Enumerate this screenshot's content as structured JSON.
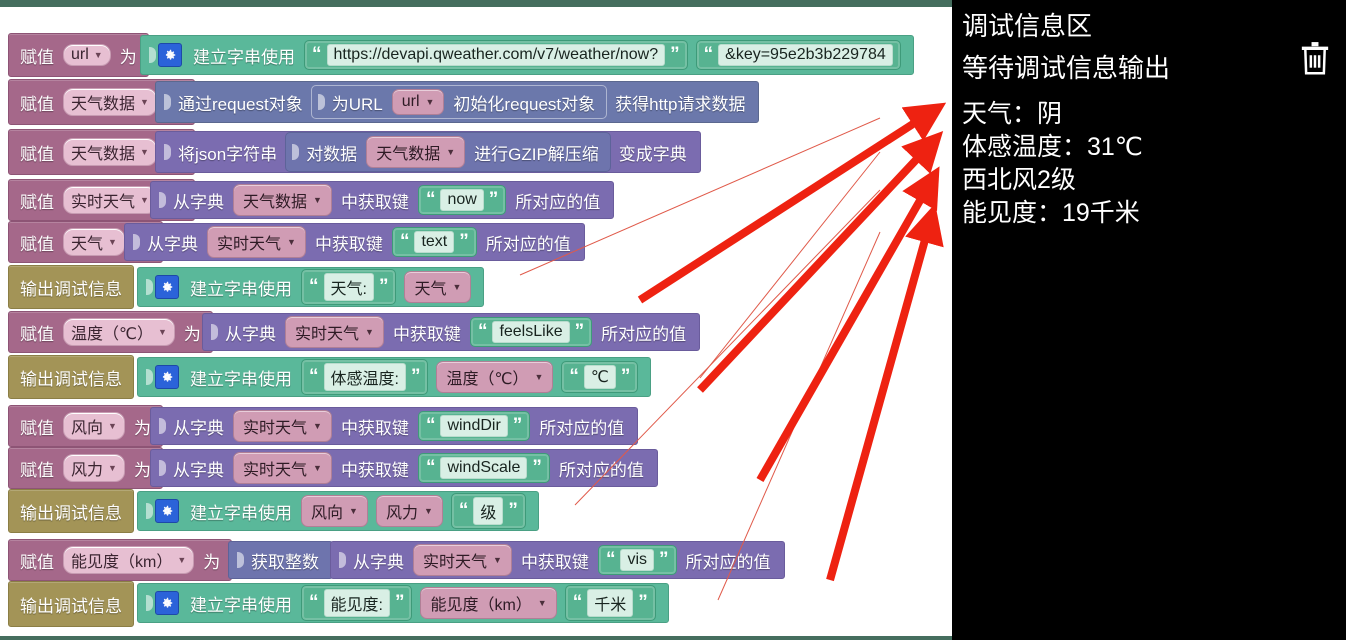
{
  "workspace": {
    "rows": [
      {
        "id": "row-url",
        "kind": "assign",
        "prefix": "赋值",
        "variable": "url",
        "suffix": "为",
        "value_block": {
          "kind": "create-text-join",
          "label": "建立字串使用",
          "gear": "gear-icon",
          "strings": [
            "https://devapi.qweather.com/v7/weather/now?",
            "&key=95e2b3b229784"
          ]
        }
      },
      {
        "id": "row-weatherdata-request",
        "kind": "assign",
        "prefix": "赋值",
        "variable": "天气数据",
        "suffix": "为",
        "value_block": {
          "kind": "http-request",
          "label_left": "通过request对象",
          "inner_label": "为URL",
          "inner_var": "url",
          "inner_label2": "初始化request对象",
          "label_right": "获得http请求数据"
        }
      },
      {
        "id": "row-weatherdata-gzip",
        "kind": "assign",
        "prefix": "赋值",
        "variable": "天气数据",
        "suffix": "为",
        "value_block": {
          "kind": "json-gzip",
          "label_left": "将json字符串",
          "inner_label": "对数据",
          "inner_var": "天气数据",
          "inner_label2": "进行GZIP解压缩",
          "label_right": "变成字典"
        }
      },
      {
        "id": "row-realtime",
        "kind": "assign",
        "prefix": "赋值",
        "variable": "实时天气",
        "suffix": "为",
        "value_block": {
          "kind": "dict-get",
          "label_left": "从字典",
          "dict_var": "天气数据",
          "label_mid": "中获取键",
          "key": "now",
          "label_right": "所对应的值"
        }
      },
      {
        "id": "row-weather-text",
        "kind": "assign",
        "prefix": "赋值",
        "variable": "天气",
        "suffix": "为",
        "value_block": {
          "kind": "dict-get",
          "label_left": "从字典",
          "dict_var": "实时天气",
          "label_mid": "中获取键",
          "key": "text",
          "label_right": "所对应的值"
        }
      },
      {
        "id": "row-out-weather",
        "kind": "debugout",
        "prefix": "输出调试信息",
        "value_block": {
          "kind": "create-text-join",
          "label": "建立字串使用",
          "gear": "gear-icon",
          "items": [
            {
              "type": "string",
              "text": "天气:"
            },
            {
              "type": "variable",
              "text": "天气"
            }
          ]
        }
      },
      {
        "id": "row-temp",
        "kind": "assign",
        "prefix": "赋值",
        "variable": "温度（℃）",
        "suffix": "为",
        "value_block": {
          "kind": "dict-get",
          "label_left": "从字典",
          "dict_var": "实时天气",
          "label_mid": "中获取键",
          "key": "feelsLike",
          "label_right": "所对应的值"
        }
      },
      {
        "id": "row-out-temp",
        "kind": "debugout",
        "prefix": "输出调试信息",
        "value_block": {
          "kind": "create-text-join",
          "label": "建立字串使用",
          "gear": "gear-icon",
          "items": [
            {
              "type": "string",
              "text": "体感温度:"
            },
            {
              "type": "variable",
              "text": "温度（℃）"
            },
            {
              "type": "string",
              "text": "℃"
            }
          ]
        }
      },
      {
        "id": "row-winddir",
        "kind": "assign",
        "prefix": "赋值",
        "variable": "风向",
        "suffix": "为",
        "value_block": {
          "kind": "dict-get",
          "label_left": "从字典",
          "dict_var": "实时天气",
          "label_mid": "中获取键",
          "key": "windDir",
          "label_right": "所对应的值"
        }
      },
      {
        "id": "row-windscale",
        "kind": "assign",
        "prefix": "赋值",
        "variable": "风力",
        "suffix": "为",
        "value_block": {
          "kind": "dict-get",
          "label_left": "从字典",
          "dict_var": "实时天气",
          "label_mid": "中获取键",
          "key": "windScale",
          "label_right": "所对应的值"
        }
      },
      {
        "id": "row-out-wind",
        "kind": "debugout",
        "prefix": "输出调试信息",
        "value_block": {
          "kind": "create-text-join",
          "label": "建立字串使用",
          "gear": "gear-icon",
          "items": [
            {
              "type": "variable",
              "text": "风向"
            },
            {
              "type": "variable",
              "text": "风力"
            },
            {
              "type": "string",
              "text": "级"
            }
          ]
        }
      },
      {
        "id": "row-vis",
        "kind": "assign",
        "prefix": "赋值",
        "variable": "能见度（km）",
        "suffix": "为",
        "value_block": {
          "kind": "int-dict-get",
          "int_label": "获取整数",
          "label_left": "从字典",
          "dict_var": "实时天气",
          "label_mid": "中获取键",
          "key": "vis",
          "label_right": "所对应的值"
        }
      },
      {
        "id": "row-out-vis",
        "kind": "debugout",
        "prefix": "输出调试信息",
        "value_block": {
          "kind": "create-text-join",
          "label": "建立字串使用",
          "gear": "gear-icon",
          "items": [
            {
              "type": "string",
              "text": "能见度:"
            },
            {
              "type": "variable",
              "text": "能见度（km）"
            },
            {
              "type": "string",
              "text": "千米"
            }
          ]
        }
      }
    ]
  },
  "debug_panel": {
    "title": "调试信息区",
    "waiting": "等待调试信息输出",
    "clear_icon": "trash-icon",
    "lines": [
      "天气：阴",
      "体感温度：31℃",
      "西北风2级",
      "能见度：19千米"
    ]
  },
  "colors": {
    "assign_block": "#a5688a",
    "debug_block": "#a39457",
    "text_block": "#5ab89a",
    "dict_block": "#7b6cb0",
    "gzip_block": "#6e74ad",
    "request_block": "#6b78ab",
    "arrow": "#ee2211",
    "panel_bg": "#000000",
    "workspace_border": "#456e5e"
  }
}
